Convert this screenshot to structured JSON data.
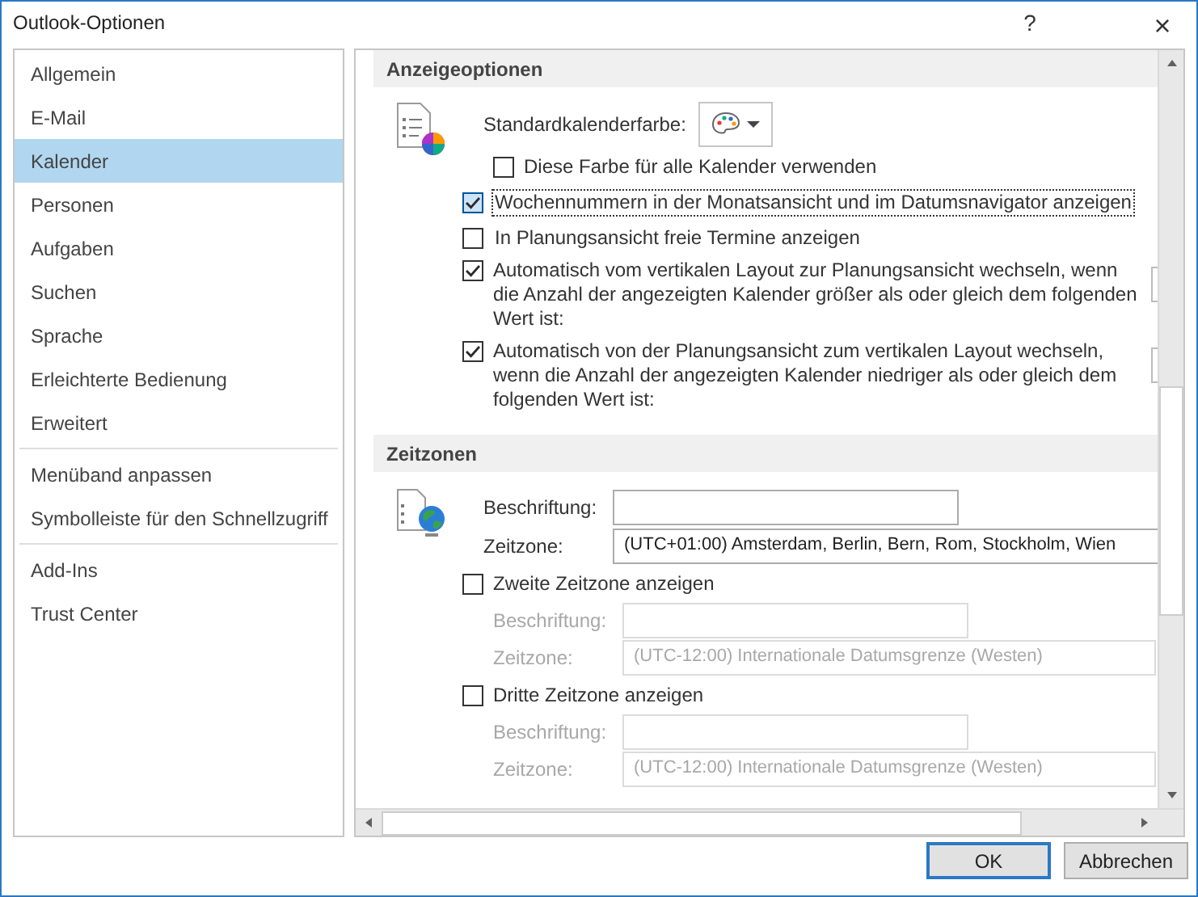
{
  "window": {
    "title": "Outlook-Optionen",
    "help": "?",
    "close": "×"
  },
  "sidebar": {
    "groups": [
      [
        {
          "label": "Allgemein",
          "selected": false
        },
        {
          "label": "E-Mail",
          "selected": false
        },
        {
          "label": "Kalender",
          "selected": true
        },
        {
          "label": "Personen",
          "selected": false
        },
        {
          "label": "Aufgaben",
          "selected": false
        },
        {
          "label": "Suchen",
          "selected": false
        },
        {
          "label": "Sprache",
          "selected": false
        },
        {
          "label": "Erleichterte Bedienung",
          "selected": false
        },
        {
          "label": "Erweitert",
          "selected": false
        }
      ],
      [
        {
          "label": "Menüband anpassen",
          "selected": false
        },
        {
          "label": "Symbolleiste für den Schnellzugriff",
          "selected": false
        }
      ],
      [
        {
          "label": "Add-Ins",
          "selected": false
        },
        {
          "label": "Trust Center",
          "selected": false
        }
      ]
    ]
  },
  "display_options": {
    "title": "Anzeigeoptionen",
    "color_label": "Standardkalenderfarbe:",
    "options": [
      {
        "kind": "nested",
        "label": "Diese Farbe für alle Kalender verwenden",
        "checked": false,
        "focused": false
      },
      {
        "kind": "plain",
        "label": "Wochennummern in der Monatsansicht und im Datumsnavigator anzeigen",
        "checked": true,
        "focused": true
      },
      {
        "kind": "plain",
        "label": "In Planungsansicht freie Termine anzeigen",
        "checked": false,
        "focused": false
      },
      {
        "kind": "with_value",
        "label": "Automatisch vom vertikalen Layout zur Planungsansicht wechseln, wenn die Anzahl der angezeigten Kalender größer als oder gleich dem folgenden Wert ist:",
        "checked": true,
        "focused": false
      },
      {
        "kind": "with_value",
        "label": "Automatisch von der Planungsansicht zum vertikalen Layout wechseln, wenn die Anzahl der angezeigten Kalender niedriger als oder gleich dem folgenden Wert ist:",
        "checked": true,
        "focused": false
      }
    ]
  },
  "time_zones": {
    "title": "Zeitzonen",
    "primary": {
      "caption_label": "Beschriftung:",
      "zone_label": "Zeitzone:",
      "zone_value": "(UTC+01:00) Amsterdam, Berlin, Bern, Rom, Stockholm, Wien"
    },
    "extra": [
      {
        "label": "Zweite Zeitzone anzeigen",
        "checked": false,
        "caption_label": "Beschriftung:",
        "zone_label": "Zeitzone:",
        "zone_value": "(UTC-12:00) Internationale Datumsgrenze (Westen)",
        "disabled": true
      },
      {
        "label": "Dritte Zeitzone anzeigen",
        "checked": false,
        "caption_label": "Beschriftung:",
        "zone_label": "Zeitzone:",
        "zone_value": "(UTC-12:00) Internationale Datumsgrenze (Westen)",
        "disabled": true
      }
    ]
  },
  "buttons": [
    {
      "label": "OK",
      "default": true
    },
    {
      "label": "Abbrechen",
      "default": false
    }
  ]
}
